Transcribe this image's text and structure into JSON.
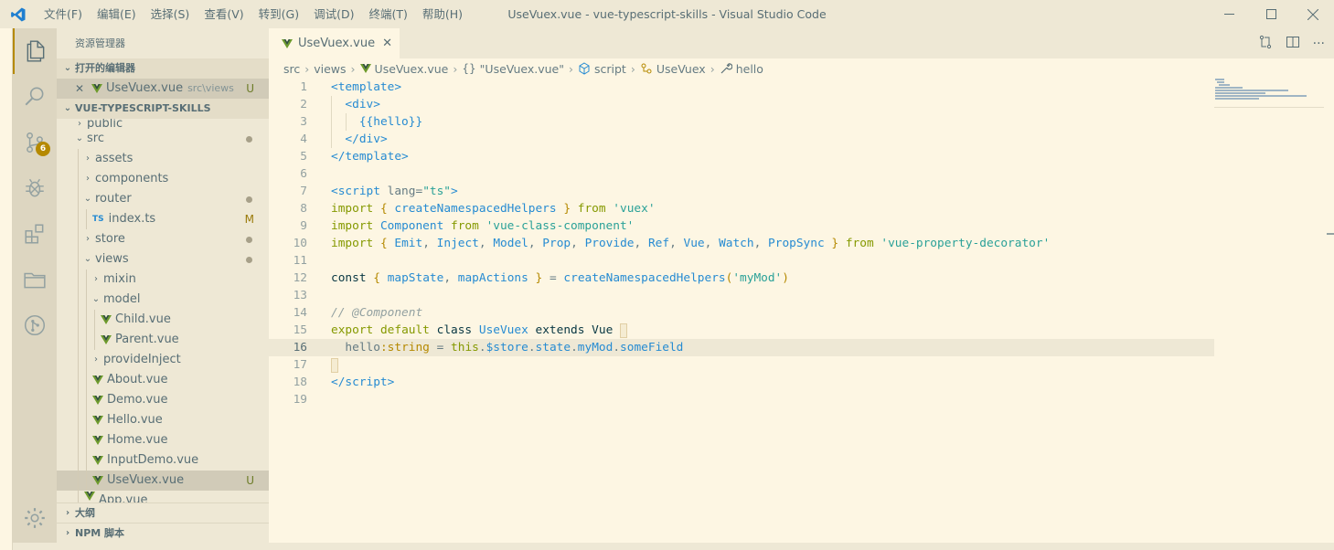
{
  "window": {
    "title": "UseVuex.vue - vue-typescript-skills - Visual Studio Code",
    "menu": [
      "文件(F)",
      "编辑(E)",
      "选择(S)",
      "查看(V)",
      "转到(G)",
      "调试(D)",
      "终端(T)",
      "帮助(H)"
    ]
  },
  "activity": {
    "scm_badge": "6"
  },
  "sidebar": {
    "header": "资源管理器",
    "open_editors_label": "打开的编辑器",
    "open_editor": {
      "name": "UseVuex.vue",
      "path": "src\\views",
      "status": "U"
    },
    "project_label": "VUE-TYPESCRIPT-SKILLS",
    "tree": [
      {
        "label": "public",
        "kind": "folder-partial",
        "indent": 1
      },
      {
        "label": "src",
        "kind": "folder-open",
        "indent": 1,
        "dot": true
      },
      {
        "label": "assets",
        "kind": "folder-closed",
        "indent": 2
      },
      {
        "label": "components",
        "kind": "folder-closed",
        "indent": 2
      },
      {
        "label": "router",
        "kind": "folder-open",
        "indent": 2,
        "dot": true
      },
      {
        "label": "index.ts",
        "kind": "ts",
        "indent": 3,
        "status": "M"
      },
      {
        "label": "store",
        "kind": "folder-closed",
        "indent": 2,
        "dot": true
      },
      {
        "label": "views",
        "kind": "folder-open",
        "indent": 2,
        "dot": true
      },
      {
        "label": "mixin",
        "kind": "folder-closed",
        "indent": 3
      },
      {
        "label": "model",
        "kind": "folder-open",
        "indent": 3
      },
      {
        "label": "Child.vue",
        "kind": "vue",
        "indent": 4
      },
      {
        "label": "Parent.vue",
        "kind": "vue",
        "indent": 4
      },
      {
        "label": "provideInject",
        "kind": "folder-closed",
        "indent": 3
      },
      {
        "label": "About.vue",
        "kind": "vue",
        "indent": 3
      },
      {
        "label": "Demo.vue",
        "kind": "vue",
        "indent": 3
      },
      {
        "label": "Hello.vue",
        "kind": "vue",
        "indent": 3
      },
      {
        "label": "Home.vue",
        "kind": "vue",
        "indent": 3
      },
      {
        "label": "InputDemo.vue",
        "kind": "vue",
        "indent": 3
      },
      {
        "label": "UseVuex.vue",
        "kind": "vue",
        "indent": 3,
        "status": "U",
        "selected": true
      },
      {
        "label": "App.vue",
        "kind": "vue-partial",
        "indent": 2
      }
    ],
    "outline_label": "大纲",
    "npm_label": "NPM 脚本"
  },
  "editor": {
    "tab_label": "UseVuex.vue",
    "breadcrumb": {
      "src": "src",
      "views": "views",
      "file": "UseVuex.vue",
      "block": "\"UseVuex.vue\"",
      "script": "script",
      "cls": "UseVuex",
      "member": "hello",
      "block_icon": "{}"
    },
    "line_numbers": [
      "1",
      "2",
      "3",
      "4",
      "5",
      "6",
      "7",
      "8",
      "9",
      "10",
      "11",
      "12",
      "13",
      "14",
      "15",
      "16",
      "17",
      "18",
      "19"
    ],
    "current_line": 16
  },
  "colors": {
    "accent": "#b58900",
    "background": "#fdf6e3",
    "sidebar": "#eee8d5"
  }
}
